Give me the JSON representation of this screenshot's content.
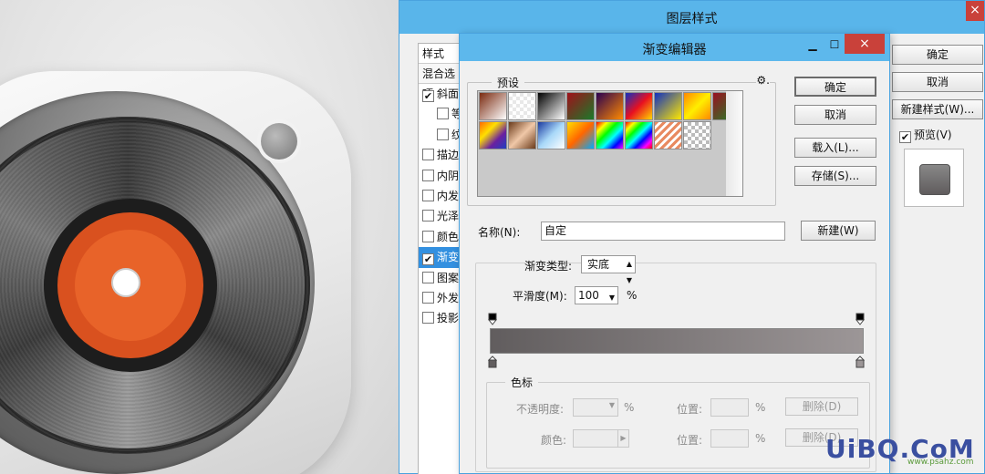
{
  "layer_style": {
    "title": "图层样式",
    "close_glyph": "×",
    "styles_header": "样式",
    "blend_options": "混合选项",
    "items": [
      {
        "label": "斜面",
        "checked": true,
        "sub": false,
        "active": false
      },
      {
        "label": "等",
        "checked": false,
        "sub": true,
        "active": false
      },
      {
        "label": "纹",
        "checked": false,
        "sub": true,
        "active": false
      },
      {
        "label": "描边",
        "checked": false,
        "sub": false,
        "active": false
      },
      {
        "label": "内阴",
        "checked": false,
        "sub": false,
        "active": false
      },
      {
        "label": "内发",
        "checked": false,
        "sub": false,
        "active": false
      },
      {
        "label": "光泽",
        "checked": false,
        "sub": false,
        "active": false
      },
      {
        "label": "颜色",
        "checked": false,
        "sub": false,
        "active": false
      },
      {
        "label": "渐变",
        "checked": true,
        "sub": false,
        "active": true
      },
      {
        "label": "图案",
        "checked": false,
        "sub": false,
        "active": false
      },
      {
        "label": "外发",
        "checked": false,
        "sub": false,
        "active": false
      },
      {
        "label": "投影",
        "checked": false,
        "sub": false,
        "active": false
      }
    ],
    "ok_label": "确定",
    "cancel_label": "取消",
    "new_style_label": "新建样式(W)...",
    "preview_label": "预览(V)",
    "preview_checked": true
  },
  "gradient_editor": {
    "title": "渐变编辑器",
    "minimize_glyph": "▁",
    "maximize_glyph": "☐",
    "close_glyph": "×",
    "presets_label": "预设",
    "gear_glyph": "⚙.",
    "presets": [
      "linear-gradient(135deg,#7a2a10,#ffffff)",
      "repeating-conic-gradient(#e8e8e8 0 25%,#fff 0 50%) 0 0/8px 8px,linear-gradient(#c66 0,#c66 0)",
      "linear-gradient(135deg,#000,#fff)",
      "linear-gradient(135deg,#a0101a,#1a7a2a)",
      "linear-gradient(135deg,#2a0050,#ff8a00)",
      "linear-gradient(135deg,#1030c0,#e81020,#ffd800)",
      "linear-gradient(135deg,#1030c0,#ffe800)",
      "linear-gradient(135deg,#ff8800,#ffee00,#ff8800)",
      "linear-gradient(135deg,#9a1020,#1a8a2a)",
      "linear-gradient(135deg,#ff6a00,#ffe000,#6a20a0,#2040c0)",
      "linear-gradient(135deg,#6a3a1a,#f0c8a8,#6a3a1a)",
      "linear-gradient(135deg,#1a3aa0,#a8d8f8,#fff)",
      "linear-gradient(135deg,#ffdd00,#ff6600,#00aaff)",
      "linear-gradient(135deg,#ff0000,#ffff00,#00ff00,#00ffff,#0000ff,#ff00ff)",
      "linear-gradient(135deg,#ff0000,#ffff00,#00ff00,#00ffff,#0000ff,#ff00ff,#ff0000)",
      "repeating-linear-gradient(135deg,#e88a60 0 3px,#fff 3px 6px)",
      "repeating-conic-gradient(#bbb 0 25%,#fff 0 50%) 0 0/8px 8px"
    ],
    "ok_label": "确定",
    "cancel_label": "取消",
    "load_label": "载入(L)...",
    "save_label": "存储(S)...",
    "name_label": "名称(N):",
    "name_value": "自定",
    "new_label": "新建(W)",
    "type_label": "渐变类型:",
    "type_value": "实底",
    "smooth_label": "平滑度(M):",
    "smooth_value": "100",
    "smooth_unit": "%",
    "gradient_colors": [
      "#615d5e",
      "#9c9697"
    ],
    "stops_label": "色标",
    "opacity_label": "不透明度:",
    "pct": "%",
    "location_label": "位置:",
    "delete_label": "删除(D)",
    "color_label": "颜色:"
  },
  "watermark": {
    "logo": "UiBQ.CoM",
    "url": "www.psahz.com"
  }
}
